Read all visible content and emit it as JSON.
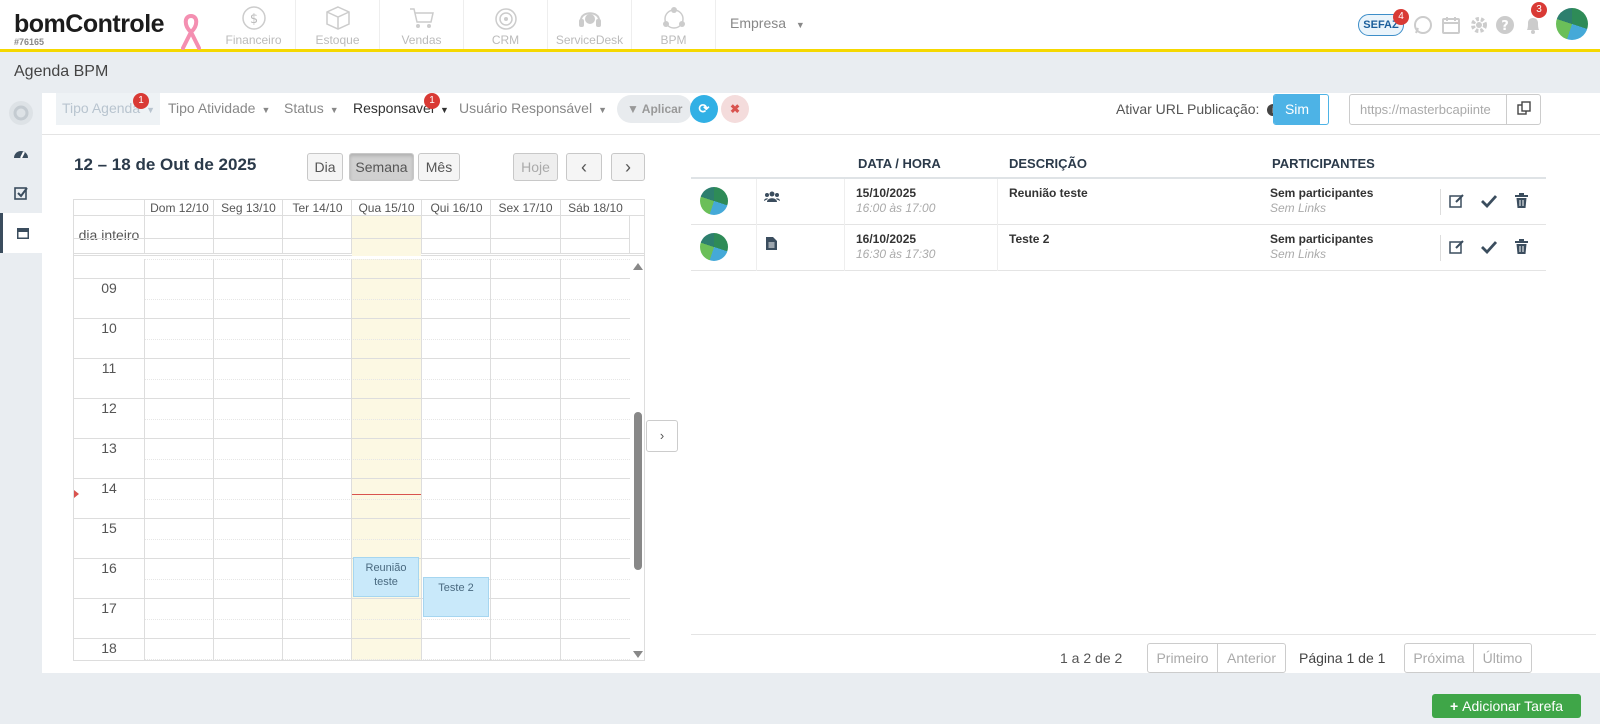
{
  "brand": {
    "logo_text": "bomControle",
    "account_id": "#76165"
  },
  "modules": [
    {
      "label": "Financeiro",
      "icon": "money-circle-icon"
    },
    {
      "label": "Estoque",
      "icon": "box-icon"
    },
    {
      "label": "Vendas",
      "icon": "cart-icon"
    },
    {
      "label": "CRM",
      "icon": "target-icon"
    },
    {
      "label": "ServiceDesk",
      "icon": "headset-icon"
    },
    {
      "label": "BPM",
      "icon": "network-icon"
    }
  ],
  "company_menu": {
    "label": "Empresa",
    "caret": "▼"
  },
  "header_right": {
    "sefaz_label": "SEFAZ",
    "sefaz_badge": "4",
    "notifications_badge": "3"
  },
  "page": {
    "title": "Agenda BPM"
  },
  "filters": {
    "tipo_agenda": {
      "label": "Tipo Agenda",
      "badge": "1"
    },
    "tipo_atividade": {
      "label": "Tipo Atividade"
    },
    "status": {
      "label": "Status"
    },
    "responsavel": {
      "label": "Responsavel",
      "badge": "1"
    },
    "usuario_responsavel": {
      "label": "Usuário Responsável"
    },
    "apply_label": "Aplicar",
    "caret": "▼"
  },
  "publication": {
    "label": "Ativar URL Publicação:",
    "toggle_value": "Sim",
    "url_value": "https://masterbcapiinte"
  },
  "calendar": {
    "title": "12 – 18 de Out de 2025",
    "views": {
      "day": "Dia",
      "week": "Semana",
      "month": "Mês"
    },
    "today_label": "Hoje",
    "prev": "‹",
    "next": "›",
    "days": [
      "Dom 12/10",
      "Seg 13/10",
      "Ter 14/10",
      "Qua 15/10",
      "Qui 16/10",
      "Sex 17/10",
      "Sáb 18/10"
    ],
    "allday_label": "dia inteiro",
    "hours": [
      "09",
      "10",
      "11",
      "12",
      "13",
      "14",
      "15",
      "16",
      "17",
      "18"
    ],
    "events": [
      {
        "title": "Reunião teste"
      },
      {
        "title": "Teste 2"
      }
    ]
  },
  "tasks": {
    "headers": {
      "date": "DATA / HORA",
      "desc": "DESCRIÇÃO",
      "participants": "PARTICIPANTES"
    },
    "rows": [
      {
        "type_icon": "users-icon",
        "date": "15/10/2025",
        "time": "16:00 às 17:00",
        "description": "Reunião teste",
        "participants": "Sem participantes",
        "links": "Sem Links"
      },
      {
        "type_icon": "document-icon",
        "date": "16/10/2025",
        "time": "16:30 às 17:30",
        "description": "Teste 2",
        "participants": "Sem participantes",
        "links": "Sem Links"
      }
    ],
    "pagination": {
      "count": "1 a 2 de 2",
      "first": "Primeiro",
      "prev": "Anterior",
      "page_info": "Página 1 de 1",
      "next": "Próxima",
      "last": "Último"
    },
    "add_label": "Adicionar Tarefa"
  },
  "colors": {
    "accent_yellow": "#f5d800",
    "primary_blue": "#4db3e6",
    "success_green": "#3fa648",
    "badge_red": "#d93a35",
    "today_bg": "#fcf8e3",
    "event_bg": "#c9e9fa"
  }
}
